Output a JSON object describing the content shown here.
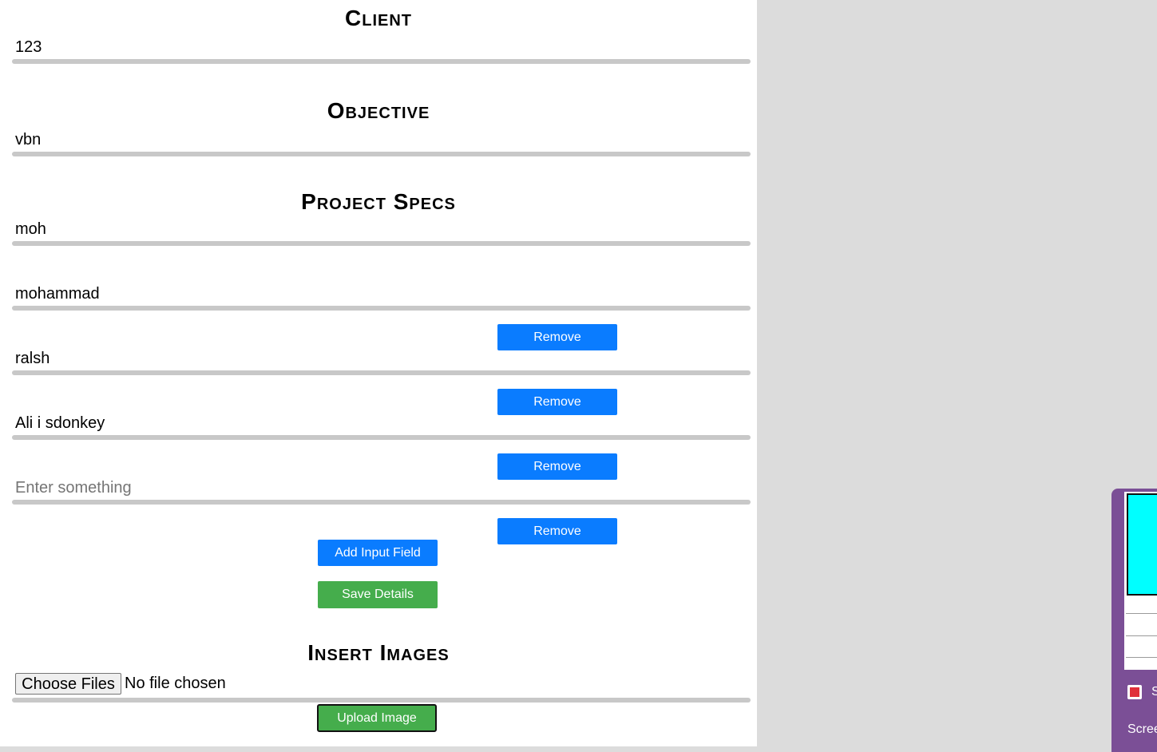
{
  "sections": {
    "client": {
      "heading": "Client",
      "value": "123"
    },
    "objective": {
      "heading": "Objective",
      "value": "vbn"
    },
    "project_specs": {
      "heading": "Project Specs",
      "fields": [
        {
          "value": "moh"
        },
        {
          "value": "mohammad"
        },
        {
          "value": "ralsh"
        },
        {
          "value": "Ali i sdonkey"
        },
        {
          "value": "",
          "placeholder": "Enter something"
        }
      ],
      "remove_label": "Remove",
      "add_label": "Add Input Field",
      "save_label": "Save Details"
    },
    "images": {
      "heading": "Insert Images",
      "choose_label": "Choose Files",
      "file_status": "No file chosen",
      "upload_label": "Upload Image"
    }
  },
  "taskbar_preview": {
    "app_label": "S",
    "window_label": "Scree"
  },
  "colors": {
    "button_blue": "#0a7cff",
    "button_green": "#45ad4c",
    "underline": "#c8c8c8",
    "background_right": "#dcdcdc"
  }
}
